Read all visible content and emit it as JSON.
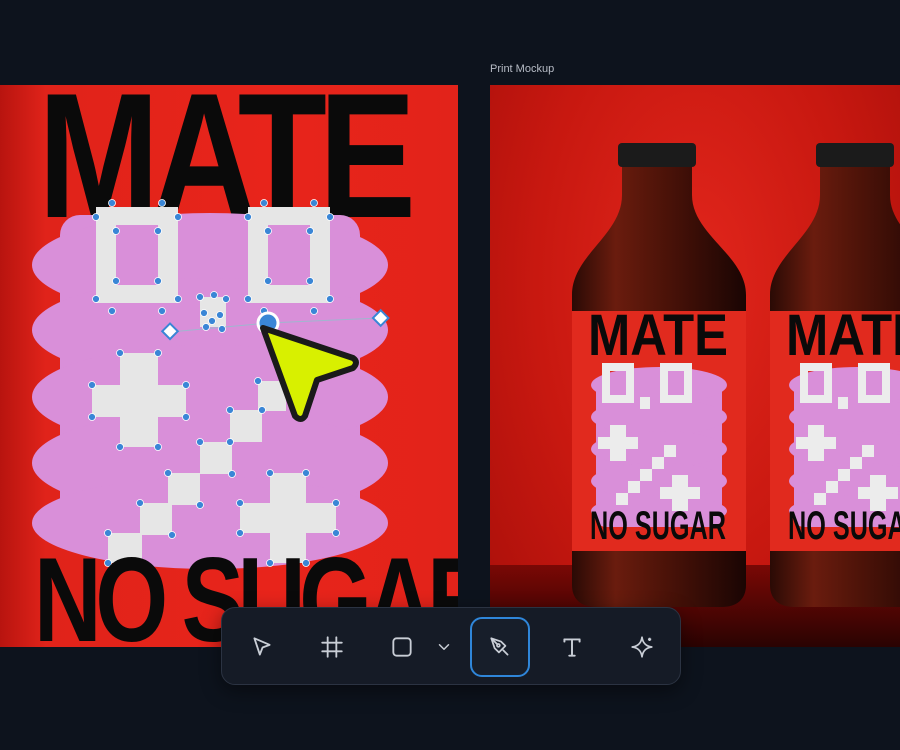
{
  "canvas": {
    "mockup_frame_label": "Print Mockup"
  },
  "poster": {
    "title": "MATE",
    "subtitle": "NO SUGAR"
  },
  "mockup": {
    "label_title": "MATE",
    "label_subtitle": "NO SUGAR"
  },
  "toolbar": {
    "tools": [
      {
        "name": "move",
        "icon": "pointer-icon"
      },
      {
        "name": "frame",
        "icon": "hash-frame-icon"
      },
      {
        "name": "rectangle",
        "icon": "square-icon"
      },
      {
        "name": "shape-options",
        "icon": "chevron-down-icon"
      },
      {
        "name": "pen",
        "icon": "pen-tool-icon",
        "active": true
      },
      {
        "name": "text",
        "icon": "text-t-icon"
      },
      {
        "name": "ai-assist",
        "icon": "sparkle-icon"
      }
    ]
  },
  "colors": {
    "background": "#0d131d",
    "poster_red": "#e8241b",
    "lilac": "#d98fd9",
    "selection_blue": "#3a86d6",
    "cursor_yellow": "#d8f000",
    "active_tool_border": "#2f86d9"
  }
}
